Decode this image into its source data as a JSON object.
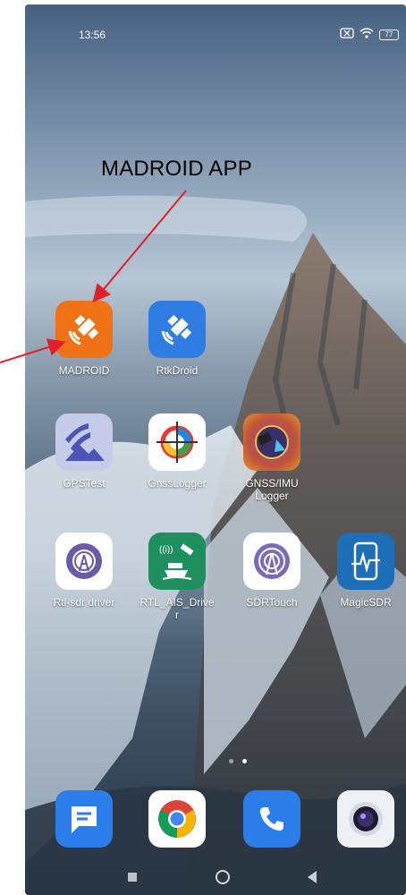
{
  "status_bar": {
    "time": "13:56",
    "battery": "77"
  },
  "annotation": {
    "label": "MADROID APP"
  },
  "apps": [
    {
      "label": "MADROID"
    },
    {
      "label": "RtkDroid"
    },
    {
      "label": "GPSTest"
    },
    {
      "label": "GnssLogger"
    },
    {
      "label": "GNSS/IMU\nLogger"
    },
    {
      "label": "Rtl-sdr driver"
    },
    {
      "label": "RTL_AIS_Drive\nr"
    },
    {
      "label": "SDRTouch"
    },
    {
      "label": "MagicSDR"
    }
  ],
  "dock": [
    "messages-icon",
    "chrome-icon",
    "phone-icon",
    "camera-icon"
  ],
  "colors": {
    "annotation_arrow": "#e0202a",
    "madroid_bg": "#f07217",
    "rtkdroid_bg": "#2f7de3"
  }
}
